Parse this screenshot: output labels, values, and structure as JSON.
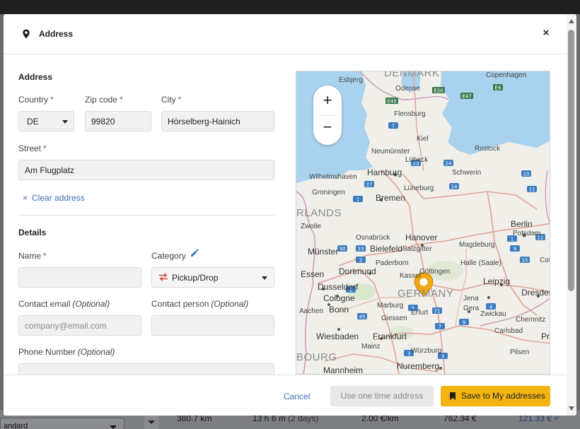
{
  "modal": {
    "title": "Address",
    "close": "×"
  },
  "address_section": {
    "title": "Address",
    "country": {
      "label": "Country",
      "value": "DE"
    },
    "zip": {
      "label": "Zip code",
      "value": "99820"
    },
    "city": {
      "label": "City",
      "value": "Hörselberg-Hainich"
    },
    "street": {
      "label": "Street",
      "value": "Am Flugplatz"
    },
    "required_mark": "*",
    "clear": {
      "icon": "×",
      "label": "Clear address"
    }
  },
  "details_section": {
    "title": "Details",
    "name": {
      "label": "Name",
      "value": ""
    },
    "category": {
      "label": "Category",
      "value": "Pickup/Drop"
    },
    "contact_email": {
      "label": "Contact email",
      "optional": "(Optional)",
      "placeholder": "company@email.com"
    },
    "contact_person": {
      "label": "Contact person",
      "optional": "(Optional)",
      "value": ""
    },
    "phone": {
      "label": "Phone Number",
      "optional": "(Optional)",
      "value": ""
    }
  },
  "map": {
    "zoom_in": "+",
    "zoom_out": "−",
    "countries": [
      "DENMARK",
      "RLANDS",
      "GERMANY",
      "BOURG"
    ],
    "cities": {
      "hamburg": "Hamburg",
      "bremen": "Bremen",
      "hanover": "Hanover",
      "berlin": "Berlin",
      "dortmund": "Dortmund",
      "dusseldorf": "Dusseldorf",
      "cologne": "Cologne",
      "bonn": "Bonn",
      "frankfurt": "Frankfurt",
      "wiesbaden": "Wiesbaden",
      "leipzig": "Leipzig",
      "dresden": "Dresden",
      "nuremberg": "Nuremberg",
      "mannheim": "Mannheim",
      "bielefeld": "Bielefeld",
      "munster": "Münster",
      "copenhagen": "Copenhagen",
      "essen": "Essen",
      "kiel": "Kiel",
      "lubeck": "Lübeck",
      "rostock": "Rostock",
      "schwerin": "Schwerin",
      "magdeburg": "Magdeburg",
      "erfurt": "Erfurt",
      "gottingen": "Göttingen",
      "kassel": "Kassel",
      "halle": "Halle (Saale)",
      "potsdam": "Potsdam",
      "odense": "Odense",
      "flensburg": "Flensburg",
      "esbjerg": "Esbjerg",
      "neumunster": "Neumünster",
      "wilhelmshaven": "Wilhelmshaven",
      "groningen": "Groningen",
      "osnabruck": "Osnabrück",
      "paderborn": "Paderborn",
      "salzgitter": "Salzgitter",
      "luneburg": "Lüneburg",
      "marburg": "Marburg",
      "giessen": "Giessen",
      "jena": "Jena",
      "zwickau": "Zwickau",
      "chemnitz": "Chemnitz",
      "wurzburg": "Würzburg",
      "carlsbad": "Carlsbad",
      "pilsen": "Pilsen",
      "aachen": "Aachen",
      "mainz": "Mainz",
      "gera": "Gera",
      "cottbus": "Cottbus",
      "zwolle": "Zwolle",
      "gdansk_partial": "Pr"
    },
    "road_badges": [
      "E20",
      "E47",
      "E45",
      "E6",
      "7",
      "23",
      "24",
      "27",
      "14",
      "11",
      "10",
      "33",
      "30",
      "2",
      "1",
      "7",
      "9",
      "71",
      "45",
      "13",
      "12",
      "15",
      "1",
      "9",
      "72",
      "4",
      "5",
      "3"
    ]
  },
  "footer": {
    "cancel": "Cancel",
    "one_time": "Use one time address",
    "save": "Save to My addresses"
  },
  "background": {
    "select_value": "andard",
    "distance": "380.7 km",
    "duration": "13 h 6 m",
    "duration_days": "(2 days)",
    "rate": "2.00 €/km",
    "total": "762.34 €",
    "extra": "121.33 €"
  },
  "colors": {
    "accent": "#3b6fb3",
    "primary_button": "#f3b412",
    "marker": "#f0a813"
  }
}
